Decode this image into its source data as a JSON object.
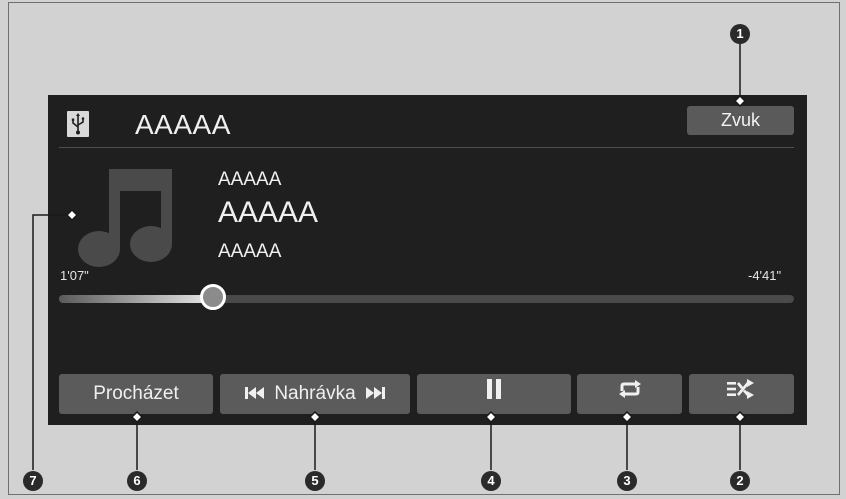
{
  "header": {
    "source_icon": "usb-icon",
    "title": "AAAAA",
    "sound_button_label": "Zvuk"
  },
  "track_info": {
    "artist": "AAAAA",
    "title": "AAAAA",
    "album": "AAAAA",
    "album_art_icon": "music-note-icon"
  },
  "playback": {
    "elapsed": "1'07\"",
    "remaining": "-4'41\"",
    "progress_fraction": 0.21
  },
  "controls": {
    "browse_label": "Procházet",
    "track_label": "Nahrávka",
    "prev_icon": "previous-track-icon",
    "next_icon": "next-track-icon",
    "pause_icon": "pause-icon",
    "repeat_icon": "repeat-icon",
    "shuffle_icon": "shuffle-icon"
  },
  "callouts": [
    "1",
    "2",
    "3",
    "4",
    "5",
    "6",
    "7"
  ],
  "colors": {
    "screen_background": "#1f1f1f",
    "button_background": "#5b5b5b",
    "page_background": "#d2d2d2"
  }
}
